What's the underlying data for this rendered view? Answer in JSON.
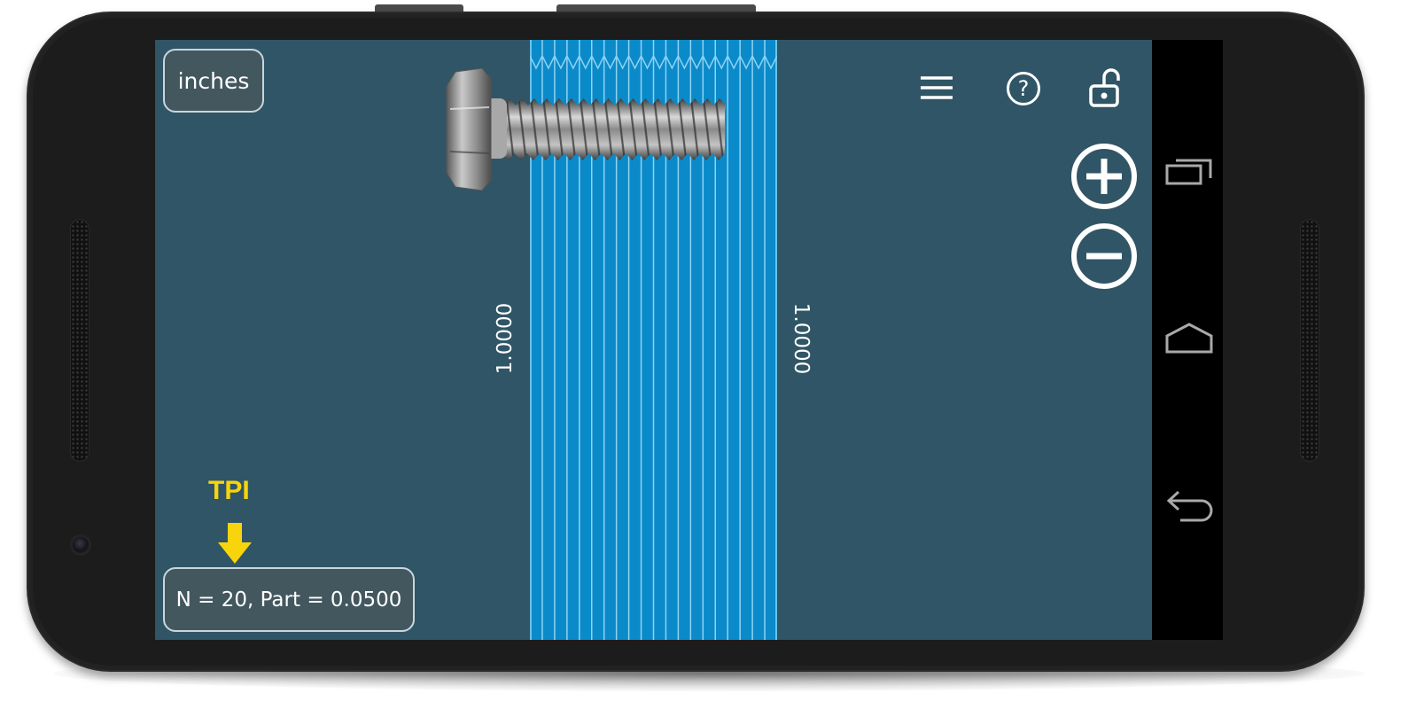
{
  "app": {
    "units_button": "inches",
    "toolbar": {
      "menu_icon": "hamburger-menu-icon",
      "help_icon": "help-circle-icon",
      "lock_icon": "unlocked-padlock-icon",
      "zoom_in_icon": "plus-circle-icon",
      "zoom_out_icon": "minus-circle-icon"
    },
    "gauge": {
      "divisions": 20,
      "left_label": "1.0000",
      "right_label": "1.0000",
      "band_color": "#0b8ac9",
      "line_color": "#8fd3f4"
    },
    "annotation": {
      "label": "TPI",
      "color": "#f7d40c",
      "arrow_icon": "down-arrow-icon"
    },
    "readout": "N = 20, Part = 0.0500",
    "background_color": "#305566"
  },
  "system_nav": {
    "recents_icon": "recent-apps-icon",
    "home_icon": "home-icon",
    "back_icon": "back-icon"
  }
}
